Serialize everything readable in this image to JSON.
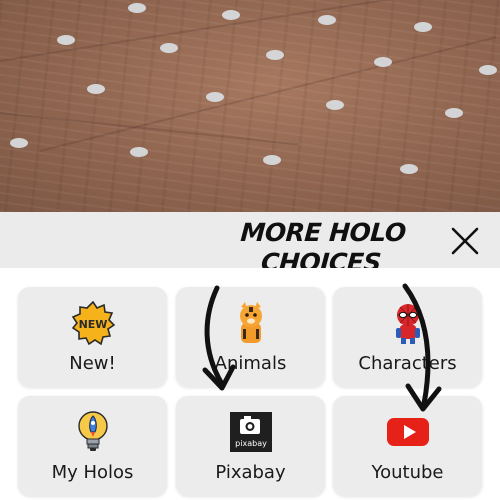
{
  "annotation": {
    "line1": "MORE HOLO",
    "line2": "CHOICES HERE!"
  },
  "close": {
    "icon": "close-icon"
  },
  "tiles": [
    {
      "label": "New!",
      "icon": "new-badge-icon"
    },
    {
      "label": "Animals",
      "icon": "tiger-icon"
    },
    {
      "label": "Characters",
      "icon": "spiderman-icon"
    },
    {
      "label": "My Holos",
      "icon": "lightbulb-rocket-icon"
    },
    {
      "label": "Pixabay",
      "icon": "pixabay-icon",
      "icon_text": "pixabay"
    },
    {
      "label": "Youtube",
      "icon": "youtube-icon"
    }
  ],
  "colors": {
    "accent_youtube": "#e62117",
    "new_badge": "#f6b21b",
    "tray_tile": "#ececec"
  }
}
